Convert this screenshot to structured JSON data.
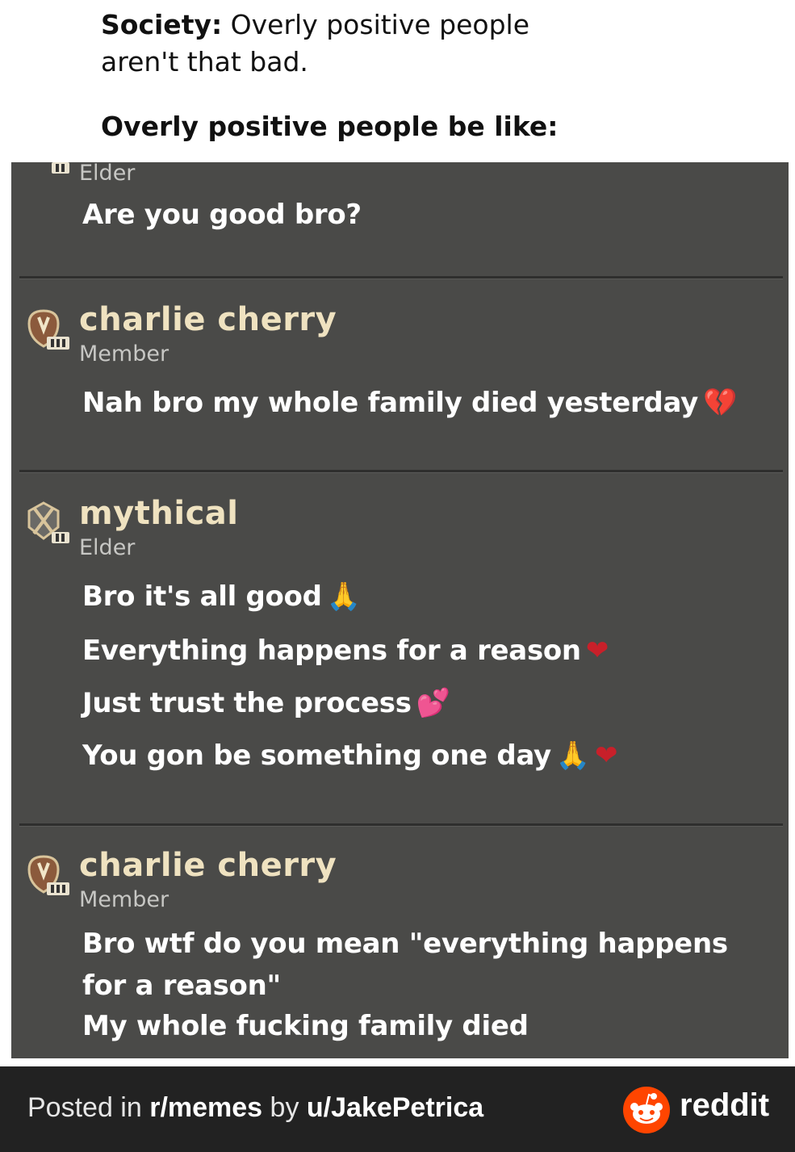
{
  "caption": {
    "society_label": "Society:",
    "society_text": " Overly positive  people aren't that bad.",
    "punchline": "Overly  positive  people be like:"
  },
  "chat": {
    "top_fragment_role": "Elder",
    "top_fragment_message": "Are you good bro?",
    "posts": [
      {
        "name": "charlie cherry",
        "role": "Member",
        "messages": [
          "Nah bro my whole family died yesterday"
        ]
      },
      {
        "name": "mythical",
        "role": "Elder",
        "messages": [
          "Bro it's all good",
          "Everything happens for a reason",
          "Just trust the process",
          "You gon be something one day"
        ]
      },
      {
        "name": "charlie cherry",
        "role": "Member",
        "messages": [
          "Bro wtf do you mean \"everything happens",
          "for a reason\"",
          "My whole fucking family died"
        ]
      }
    ],
    "emoji": {
      "broken_heart": "💔",
      "pray": "🙏",
      "heart": "❤",
      "sparkling_heart": "💕"
    }
  },
  "footer": {
    "posted_in": "Posted in ",
    "subreddit": "r/memes",
    "by": " by ",
    "user": "u/JakePetrica",
    "brand": "reddit",
    "brand_color": "#ff4500"
  }
}
